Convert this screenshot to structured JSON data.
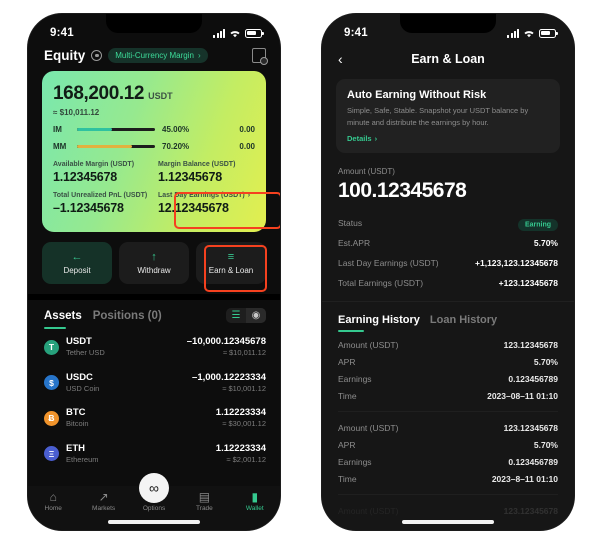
{
  "left_phone": {
    "status_bar": {
      "time": "9:41",
      "signal_icon": "cellular-bars-icon",
      "wifi_icon": "wifi-icon",
      "battery_icon": "battery-icon"
    },
    "header": {
      "title": "Equity",
      "eye_icon": "eye-icon",
      "account_mode": "Multi-Currency Margin",
      "chevron": "›",
      "history_icon": "order-history-icon"
    },
    "equity_card": {
      "amount": "168,200.12",
      "currency": "USDT",
      "approx": "≈ $10,011.12",
      "bars": [
        {
          "label": "IM",
          "percent": "45.00%",
          "value": "0.00",
          "fill": 45,
          "color": "#2fc2a0"
        },
        {
          "label": "MM",
          "percent": "70.20%",
          "value": "0.00",
          "fill": 70,
          "color": "#e2b13f"
        }
      ],
      "stats": [
        {
          "label": "Available Margin (USDT)",
          "value": "1.12345678"
        },
        {
          "label": "Margin Balance (USDT)",
          "value": "1.12345678"
        },
        {
          "label": "Total Unrealized PnL (USDT)",
          "value": "–1.12345678"
        },
        {
          "label": "Last Day Earnings (USDT)",
          "value": "12.12345678",
          "chevron": "›",
          "highlighted": true
        }
      ],
      "highlight_color": "#f5411f"
    },
    "actions": [
      {
        "label": "Deposit",
        "icon": "deposit-icon",
        "glyph": "←"
      },
      {
        "label": "Withdraw",
        "icon": "withdraw-icon",
        "glyph": "↑"
      },
      {
        "label": "Earn & Loan",
        "icon": "earn-loan-icon",
        "glyph": "≡",
        "highlighted": true
      }
    ],
    "assets_section": {
      "tabs": [
        {
          "label": "Assets",
          "active": true
        },
        {
          "label": "Positions (0)",
          "active": false
        }
      ],
      "view_list_icon": "list-view-icon",
      "view_chart_icon": "pie-chart-view-icon",
      "rows": [
        {
          "symbol": "USDT",
          "name": "Tether USD",
          "amount": "–10,000.12345678",
          "usd": "≈ $10,011.12",
          "badge": "T",
          "color": "#27a17c"
        },
        {
          "symbol": "USDC",
          "name": "USD Coin",
          "amount": "–1,000.12223334",
          "usd": "≈ $10,001.12",
          "badge": "$",
          "color": "#2775ca"
        },
        {
          "symbol": "BTC",
          "name": "Bitcoin",
          "amount": "1.12223334",
          "usd": "≈ $30,001.12",
          "badge": "Ƀ",
          "color": "#f0932b"
        },
        {
          "symbol": "ETH",
          "name": "Ethereum",
          "amount": "1.12223334",
          "usd": "≈ $2,001.12",
          "badge": "Ξ",
          "color": "#4a5ed0"
        }
      ]
    },
    "tabbar": [
      {
        "label": "Home",
        "icon": "home-icon",
        "glyph": "⌂",
        "active": false
      },
      {
        "label": "Markets",
        "icon": "markets-chart-icon",
        "glyph": "↗",
        "active": false
      },
      {
        "label": "Options",
        "icon": "options-infinity-icon",
        "glyph": "∞",
        "active": false
      },
      {
        "label": "Trade",
        "icon": "trade-icon",
        "glyph": "▤",
        "active": false
      },
      {
        "label": "Wallet",
        "icon": "wallet-icon",
        "glyph": "▮",
        "active": true
      }
    ],
    "fab_glyph": "∞"
  },
  "right_phone": {
    "status_bar": {
      "time": "9:41",
      "signal_icon": "cellular-bars-icon",
      "wifi_icon": "wifi-icon",
      "battery_icon": "battery-icon"
    },
    "nav": {
      "back_icon": "back-chevron-icon",
      "back_glyph": "‹",
      "title": "Earn & Loan"
    },
    "promo": {
      "title": "Auto Earning Without Risk",
      "description": "Simple, Safe, Stable. Snapshot your USDT balance by minute and distribute the earnings by hour.",
      "link": "Details",
      "link_chevron": "›"
    },
    "summary": {
      "amount_label": "Amount (USDT)",
      "amount_value": "100.12345678",
      "rows": [
        {
          "key": "Status",
          "value": "Earning",
          "type": "badge"
        },
        {
          "key": "Est.APR",
          "value": "5.70%",
          "type": "text"
        },
        {
          "key": "Last Day Earnings (USDT)",
          "value": "+1,123,123.12345678",
          "type": "text"
        },
        {
          "key": "Total Earnings (USDT)",
          "value": "+123.12345678",
          "type": "text"
        }
      ]
    },
    "history": {
      "tabs": [
        {
          "label": "Earning History",
          "active": true
        },
        {
          "label": "Loan History",
          "active": false
        }
      ],
      "entries": [
        [
          {
            "key": "Amount (USDT)",
            "value": "123.12345678"
          },
          {
            "key": "APR",
            "value": "5.70%"
          },
          {
            "key": "Earnings",
            "value": "0.123456789"
          },
          {
            "key": "Time",
            "value": "2023–08–11 01:10"
          }
        ],
        [
          {
            "key": "Amount (USDT)",
            "value": "123.12345678"
          },
          {
            "key": "APR",
            "value": "5.70%"
          },
          {
            "key": "Earnings",
            "value": "0.123456789"
          },
          {
            "key": "Time",
            "value": "2023–8–11 01:10"
          }
        ],
        [
          {
            "key": "Amount (USDT)",
            "value": "123.12345678"
          }
        ]
      ]
    }
  }
}
